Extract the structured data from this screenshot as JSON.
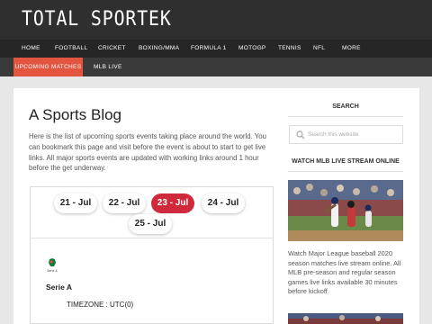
{
  "site": {
    "title": "TOTAL SPORTEK"
  },
  "nav": {
    "items": [
      {
        "label": "HOME"
      },
      {
        "label": "FOOTBALL"
      },
      {
        "label": "CRICKET"
      },
      {
        "label": "BOXING/MMA"
      },
      {
        "label": "FORMULA 1"
      },
      {
        "label": "MOTOGP"
      },
      {
        "label": "TENNIS"
      },
      {
        "label": "NFL"
      },
      {
        "label": "MORE"
      }
    ]
  },
  "subnav": {
    "items": [
      {
        "label": "UPCOMING MATCHES",
        "active": true
      },
      {
        "label": "MLB LIVE",
        "active": false
      }
    ]
  },
  "post": {
    "title": "A Sports Blog",
    "intro": "Here is the list of upcoming sports events taking place around the world. You can bookmark this page and visit before the event is about to start to get live links. All major sports events are updated with working links around 1 hour before the get underway."
  },
  "events": {
    "dates": [
      {
        "label": "21 - Jul",
        "active": false
      },
      {
        "label": "22 - Jul",
        "active": false
      },
      {
        "label": "23 - Jul",
        "active": true
      },
      {
        "label": "24 - Jul",
        "active": false
      },
      {
        "label": "25 - Jul",
        "active": false
      }
    ],
    "league": {
      "name": "Serie A",
      "logo_text": "Serie A",
      "logo_icon": "serie-a-logo"
    },
    "timezone": "TIMEZONE : UTC(0)"
  },
  "sidebar": {
    "search": {
      "heading": "SEARCH",
      "placeholder": "Search this website",
      "icon": "search-icon"
    },
    "mlb": {
      "heading": "WATCH MLB LIVE STREAM ONLINE",
      "text": "Watch Major League baseball 2020 season matches live stream online. All MLB pre-season and regular season games live links available 30 minutes before kickoff."
    }
  },
  "colors": {
    "header_bg": "#2f2f2f",
    "nav_bg": "#262626",
    "subnav_bg": "#3a3a3a",
    "accent": "#e3553f",
    "active_date": "#cf2a3c",
    "page_bg": "#e7e7e7"
  }
}
